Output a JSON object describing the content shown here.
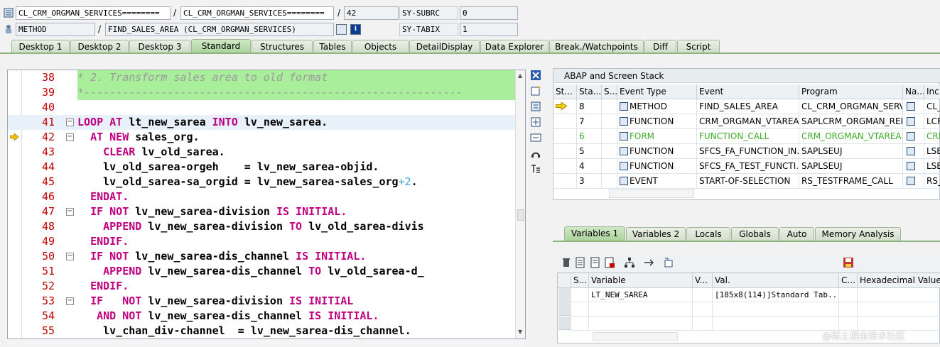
{
  "header": {
    "row1": {
      "class_field": "CL_CRM_ORGMAN_SERVICES========",
      "class_field2": "CL_CRM_ORGMAN_SERVICES========",
      "line_field": "42",
      "sy_label": "SY-SUBRC",
      "sy_value": "0"
    },
    "row2": {
      "type_field": "METHOD",
      "name_field": "FIND_SALES_AREA (CL_CRM_ORGMAN_SERVICES)",
      "sy_label": "SY-TABIX",
      "sy_value": "1",
      "info_button": "i"
    },
    "slash": "/"
  },
  "tabs": [
    {
      "label": "Desktop 1"
    },
    {
      "label": "Desktop 2"
    },
    {
      "label": "Desktop 3"
    },
    {
      "label": "Standard",
      "active": true
    },
    {
      "label": "Structures"
    },
    {
      "label": "Tables"
    },
    {
      "label": "Objects"
    },
    {
      "label": "DetailDisplay"
    },
    {
      "label": "Data Explorer"
    },
    {
      "label": "Break./Watchpoints"
    },
    {
      "label": "Diff"
    },
    {
      "label": "Script"
    }
  ],
  "editor": {
    "lines": [
      {
        "num": "38",
        "text": "* 2. Transform sales area to old format",
        "comment": true
      },
      {
        "num": "39",
        "text": "*-----------------------------------------------------------",
        "comment": true
      },
      {
        "num": "40",
        "text": ""
      },
      {
        "num": "41",
        "fold": true,
        "parts": [
          [
            "kw",
            "LOOP "
          ],
          [
            "kw",
            "AT "
          ],
          [
            "",
            "lt_new_sarea "
          ],
          [
            "kw",
            "INTO "
          ],
          [
            "",
            "lv_new_sarea."
          ]
        ],
        "indent": "",
        "current": true
      },
      {
        "num": "42",
        "fold": true,
        "marker": true,
        "parts": [
          [
            "kw",
            "AT NEW "
          ],
          [
            "",
            "sales_org."
          ]
        ],
        "indent": "  "
      },
      {
        "num": "43",
        "parts": [
          [
            "kw",
            "CLEAR "
          ],
          [
            "",
            "lv_old_sarea."
          ]
        ],
        "indent": "    "
      },
      {
        "num": "44",
        "parts": [
          [
            "",
            "lv_old_sarea-orgeh    = lv_new_sarea-objid."
          ]
        ],
        "indent": "    "
      },
      {
        "num": "45",
        "parts": [
          [
            "",
            "lv_old_sarea-sa_orgid = lv_new_sarea-sales_org"
          ],
          [
            "num",
            "+2"
          ],
          [
            "",
            "."
          ]
        ],
        "indent": "    "
      },
      {
        "num": "46",
        "parts": [
          [
            "kw",
            "ENDAT."
          ]
        ],
        "indent": "  "
      },
      {
        "num": "47",
        "fold": true,
        "parts": [
          [
            "kw",
            "IF NOT "
          ],
          [
            "",
            "lv_new_sarea-division "
          ],
          [
            "kw",
            "IS INITIAL."
          ]
        ],
        "indent": "  "
      },
      {
        "num": "48",
        "parts": [
          [
            "kw",
            "APPEND "
          ],
          [
            "",
            "lv_new_sarea-division "
          ],
          [
            "kw",
            "TO "
          ],
          [
            "",
            "lv_old_sarea-divis"
          ]
        ],
        "indent": "    "
      },
      {
        "num": "49",
        "parts": [
          [
            "kw",
            "ENDIF."
          ]
        ],
        "indent": "  "
      },
      {
        "num": "50",
        "fold": true,
        "parts": [
          [
            "kw",
            "IF NOT "
          ],
          [
            "",
            "lv_new_sarea-dis_channel "
          ],
          [
            "kw",
            "IS INITIAL."
          ]
        ],
        "indent": "  "
      },
      {
        "num": "51",
        "parts": [
          [
            "kw",
            "APPEND "
          ],
          [
            "",
            "lv_new_sarea-dis_channel "
          ],
          [
            "kw",
            "TO "
          ],
          [
            "",
            "lv_old_sarea-d_"
          ]
        ],
        "indent": "    "
      },
      {
        "num": "52",
        "parts": [
          [
            "kw",
            "ENDIF."
          ]
        ],
        "indent": "  "
      },
      {
        "num": "53",
        "fold": true,
        "parts": [
          [
            "kw",
            "IF   NOT "
          ],
          [
            "",
            "lv_new_sarea-division "
          ],
          [
            "kw",
            "IS INITIAL"
          ]
        ],
        "indent": "  "
      },
      {
        "num": "54",
        "parts": [
          [
            "kw",
            "AND NOT "
          ],
          [
            "",
            "lv_new_sarea-dis_channel "
          ],
          [
            "kw",
            "IS INITIAL."
          ]
        ],
        "indent": "   "
      },
      {
        "num": "55",
        "parts": [
          [
            "",
            "lv_chan_div-channel  = lv_new_sarea-dis_channel."
          ]
        ],
        "indent": "    "
      }
    ]
  },
  "stack": {
    "title": "ABAP and Screen Stack",
    "columns": [
      "St...",
      "Sta...",
      "S...",
      "Event Type",
      "Event",
      "Program",
      "Na...",
      "Inc"
    ],
    "rows": [
      {
        "stack": "8",
        "type": "METHOD",
        "event": "FIND_SALES_AREA",
        "program": "CL_CRM_ORGMAN_SERV...",
        "inc": "CL_",
        "current": true
      },
      {
        "stack": "7",
        "type": "FUNCTION",
        "event": "CRM_ORGMAN_VTAREA...",
        "program": "SAPLCRM_ORGMAN_REP...",
        "inc": "LCR"
      },
      {
        "stack": "6",
        "type": "FORM",
        "event": "FUNCTION_CALL",
        "program": "CRM_ORGMAN_VTAREA...",
        "inc": "CRM",
        "green": true
      },
      {
        "stack": "5",
        "type": "FUNCTION",
        "event": "SFCS_FA_FUNCTION_IN...",
        "program": "SAPLSEUJ",
        "inc": "LSE"
      },
      {
        "stack": "4",
        "type": "FUNCTION",
        "event": "SFCS_FA_TEST_FUNCTI...",
        "program": "SAPLSEUJ",
        "inc": "LSE"
      },
      {
        "stack": "3",
        "type": "EVENT",
        "event": "START-OF-SELECTION",
        "program": "RS_TESTFRAME_CALL",
        "inc": "RS_"
      }
    ]
  },
  "vartabs": [
    {
      "label": "Variables 1",
      "active": true
    },
    {
      "label": "Variables 2"
    },
    {
      "label": "Locals"
    },
    {
      "label": "Globals"
    },
    {
      "label": "Auto"
    },
    {
      "label": "Memory Analysis"
    }
  ],
  "variables": {
    "columns": [
      "S...",
      "Variable",
      "V...",
      "Val.",
      "C...",
      "Hexadecimal Value"
    ],
    "rows": [
      {
        "variable": "LT_NEW_SAREA",
        "value": "[185x8(114)]Standard Tab..."
      }
    ]
  },
  "watermark": "@稀土掘金技术社区",
  "colors": {
    "tab_active": "#a9d39a",
    "comment_bg": "#a8ee9b",
    "keyword": "#c00080",
    "line_number": "#c00000"
  }
}
